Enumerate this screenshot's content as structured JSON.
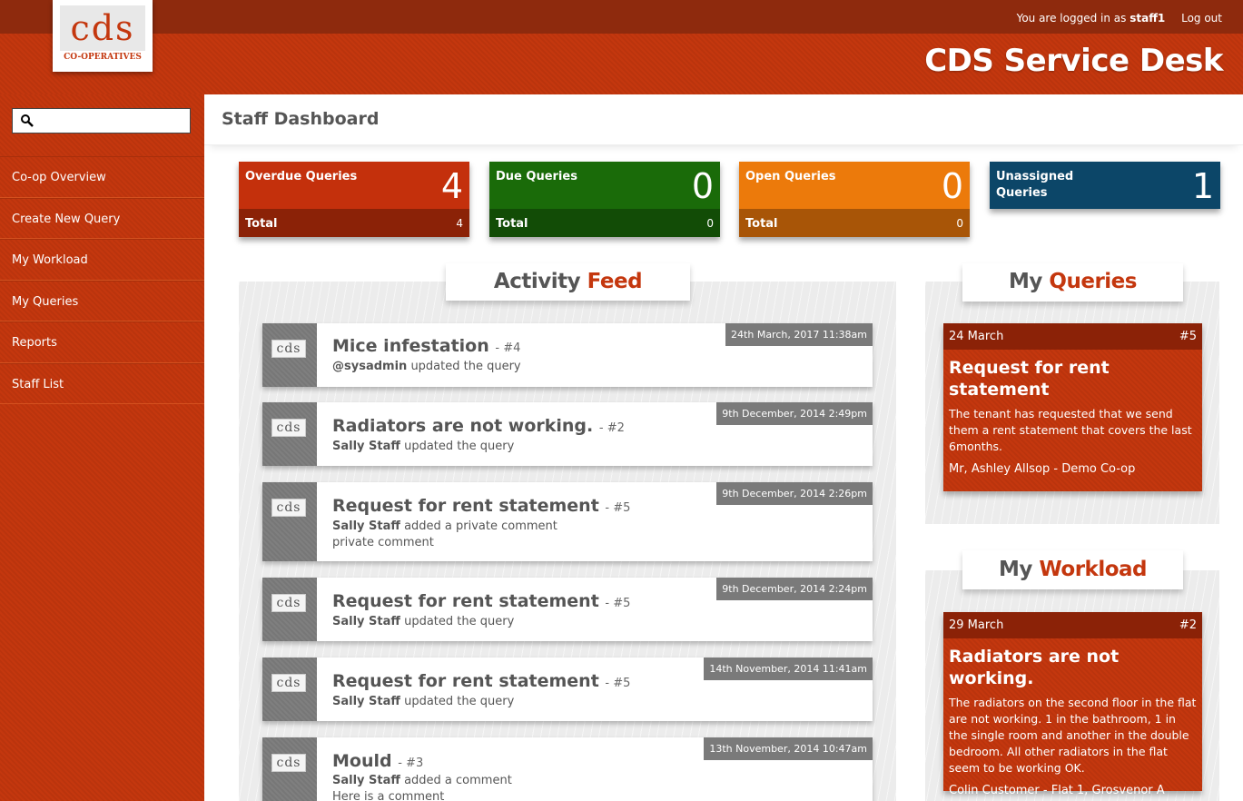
{
  "header": {
    "login_prefix": "You are logged in as",
    "username": "staff1",
    "logout": "Log out",
    "app_title": "CDS Service Desk",
    "logo_text": "cds",
    "logo_sub": "CO-OPERATIVES"
  },
  "sidebar": {
    "search_placeholder": "",
    "items": [
      {
        "label": "Co-op Overview"
      },
      {
        "label": "Create New Query"
      },
      {
        "label": "My Workload"
      },
      {
        "label": "My Queries"
      },
      {
        "label": "Reports"
      },
      {
        "label": "Staff List"
      }
    ]
  },
  "page": {
    "title": "Staff Dashboard"
  },
  "stats": [
    {
      "label": "Overdue Queries",
      "value": "4",
      "total_label": "Total",
      "total": "4",
      "color": "#c4300c"
    },
    {
      "label": "Due Queries",
      "value": "0",
      "total_label": "Total",
      "total": "0",
      "color": "#1a6b09"
    },
    {
      "label": "Open Queries",
      "value": "0",
      "total_label": "Total",
      "total": "0",
      "color": "#ec7a0b"
    },
    {
      "label": "Unassigned Queries",
      "value": "1",
      "color": "#0c4668"
    }
  ],
  "activity": {
    "heading_a": "Activity",
    "heading_b": "Feed",
    "items": [
      {
        "title": "Mice infestation",
        "ref": "- #4",
        "actor": "@sysadmin",
        "action": "updated the query",
        "extra": "",
        "date": "24th March, 2017 11:38am"
      },
      {
        "title": "Radiators are not working.",
        "ref": "- #2",
        "actor": "Sally Staff",
        "action": "updated the query",
        "extra": "",
        "date": "9th December, 2014 2:49pm"
      },
      {
        "title": "Request for rent statement",
        "ref": "- #5",
        "actor": "Sally Staff",
        "action": "added a private comment",
        "extra": "private comment",
        "date": "9th December, 2014 2:26pm"
      },
      {
        "title": "Request for rent statement",
        "ref": "- #5",
        "actor": "Sally Staff",
        "action": "updated the query",
        "extra": "",
        "date": "9th December, 2014 2:24pm"
      },
      {
        "title": "Request for rent statement",
        "ref": "- #5",
        "actor": "Sally Staff",
        "action": "updated the query",
        "extra": "",
        "date": "14th November, 2014 11:41am"
      },
      {
        "title": "Mould",
        "ref": "- #3",
        "actor": "Sally Staff",
        "action": "added a comment",
        "extra": "Here is a comment",
        "date": "13th November, 2014 10:47am"
      }
    ]
  },
  "my_queries": {
    "heading_a": "My",
    "heading_b": "Queries",
    "card": {
      "date": "24 March",
      "id": "#5",
      "title": "Request for rent statement",
      "description": "The tenant has requested that we send them a rent statement that covers the last 6months.",
      "footer": "Mr, Ashley Allsop - Demo Co-op"
    }
  },
  "my_workload": {
    "heading_a": "My",
    "heading_b": "Workload",
    "card": {
      "date": "29 March",
      "id": "#2",
      "title": "Radiators are not working.",
      "description": "The radiators on the second floor in the flat are not working. 1 in the bathroom, 1 in the single room and another in the double bedroom. All other radiators in the flat seem to be working OK.",
      "footer": "Colin Customer - Flat 1, Grosvenor A"
    }
  }
}
